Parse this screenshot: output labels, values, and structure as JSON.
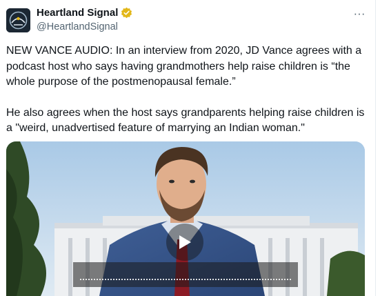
{
  "post": {
    "author": {
      "display_name": "Heartland Signal",
      "handle": "@HeartlandSignal",
      "verified_badge_color": "#e2b719",
      "avatar_icon": "heartland-signal-logo"
    },
    "more_label": "···",
    "paragraphs": [
      "NEW VANCE AUDIO: In an interview from 2020, JD Vance agrees with a podcast host who says having grandmothers help raise children is “the whole purpose of the postmenopausal female.”",
      "He also agrees when the host says grandparents helping raise children is a \"weird, unadvertised feature of marrying an Indian woman.\""
    ],
    "media": {
      "type": "video",
      "play_icon": "play-icon"
    }
  },
  "colors": {
    "text": "#0f1419",
    "muted": "#536471"
  }
}
